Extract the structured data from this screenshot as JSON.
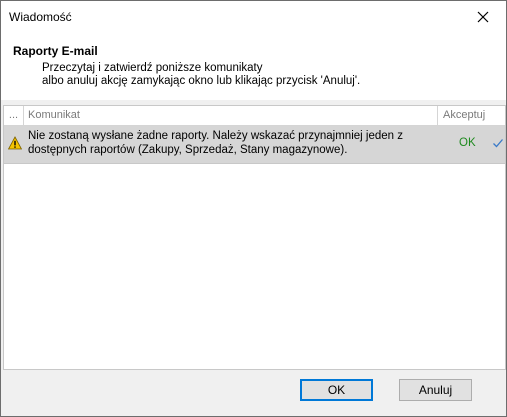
{
  "window": {
    "title": "Wiadomość"
  },
  "header": {
    "title": "Raporty E-mail",
    "line1": "Przeczytaj i zatwierdź poniższe komunikaty",
    "line2": "albo anuluj akcję zamykając okno lub klikając przycisk 'Anuluj'."
  },
  "grid": {
    "columns": {
      "dots": "...",
      "message": "Komunikat",
      "accept": "Akceptuj"
    },
    "rows": [
      {
        "icon": "warning-icon",
        "message": "Nie zostaną wysłane żadne raporty. Należy wskazać przynajmniej jeden z dostępnych raportów (Zakupy, Sprzedaż, Stany magazynowe).",
        "status": "OK",
        "accepted": true
      }
    ]
  },
  "buttons": {
    "ok": "OK",
    "cancel": "Anuluj"
  },
  "colors": {
    "focus_border": "#0078d7",
    "ok_text": "#1f8a1f",
    "row_selected": "#d6d6d6",
    "warning": "#f5c400"
  }
}
